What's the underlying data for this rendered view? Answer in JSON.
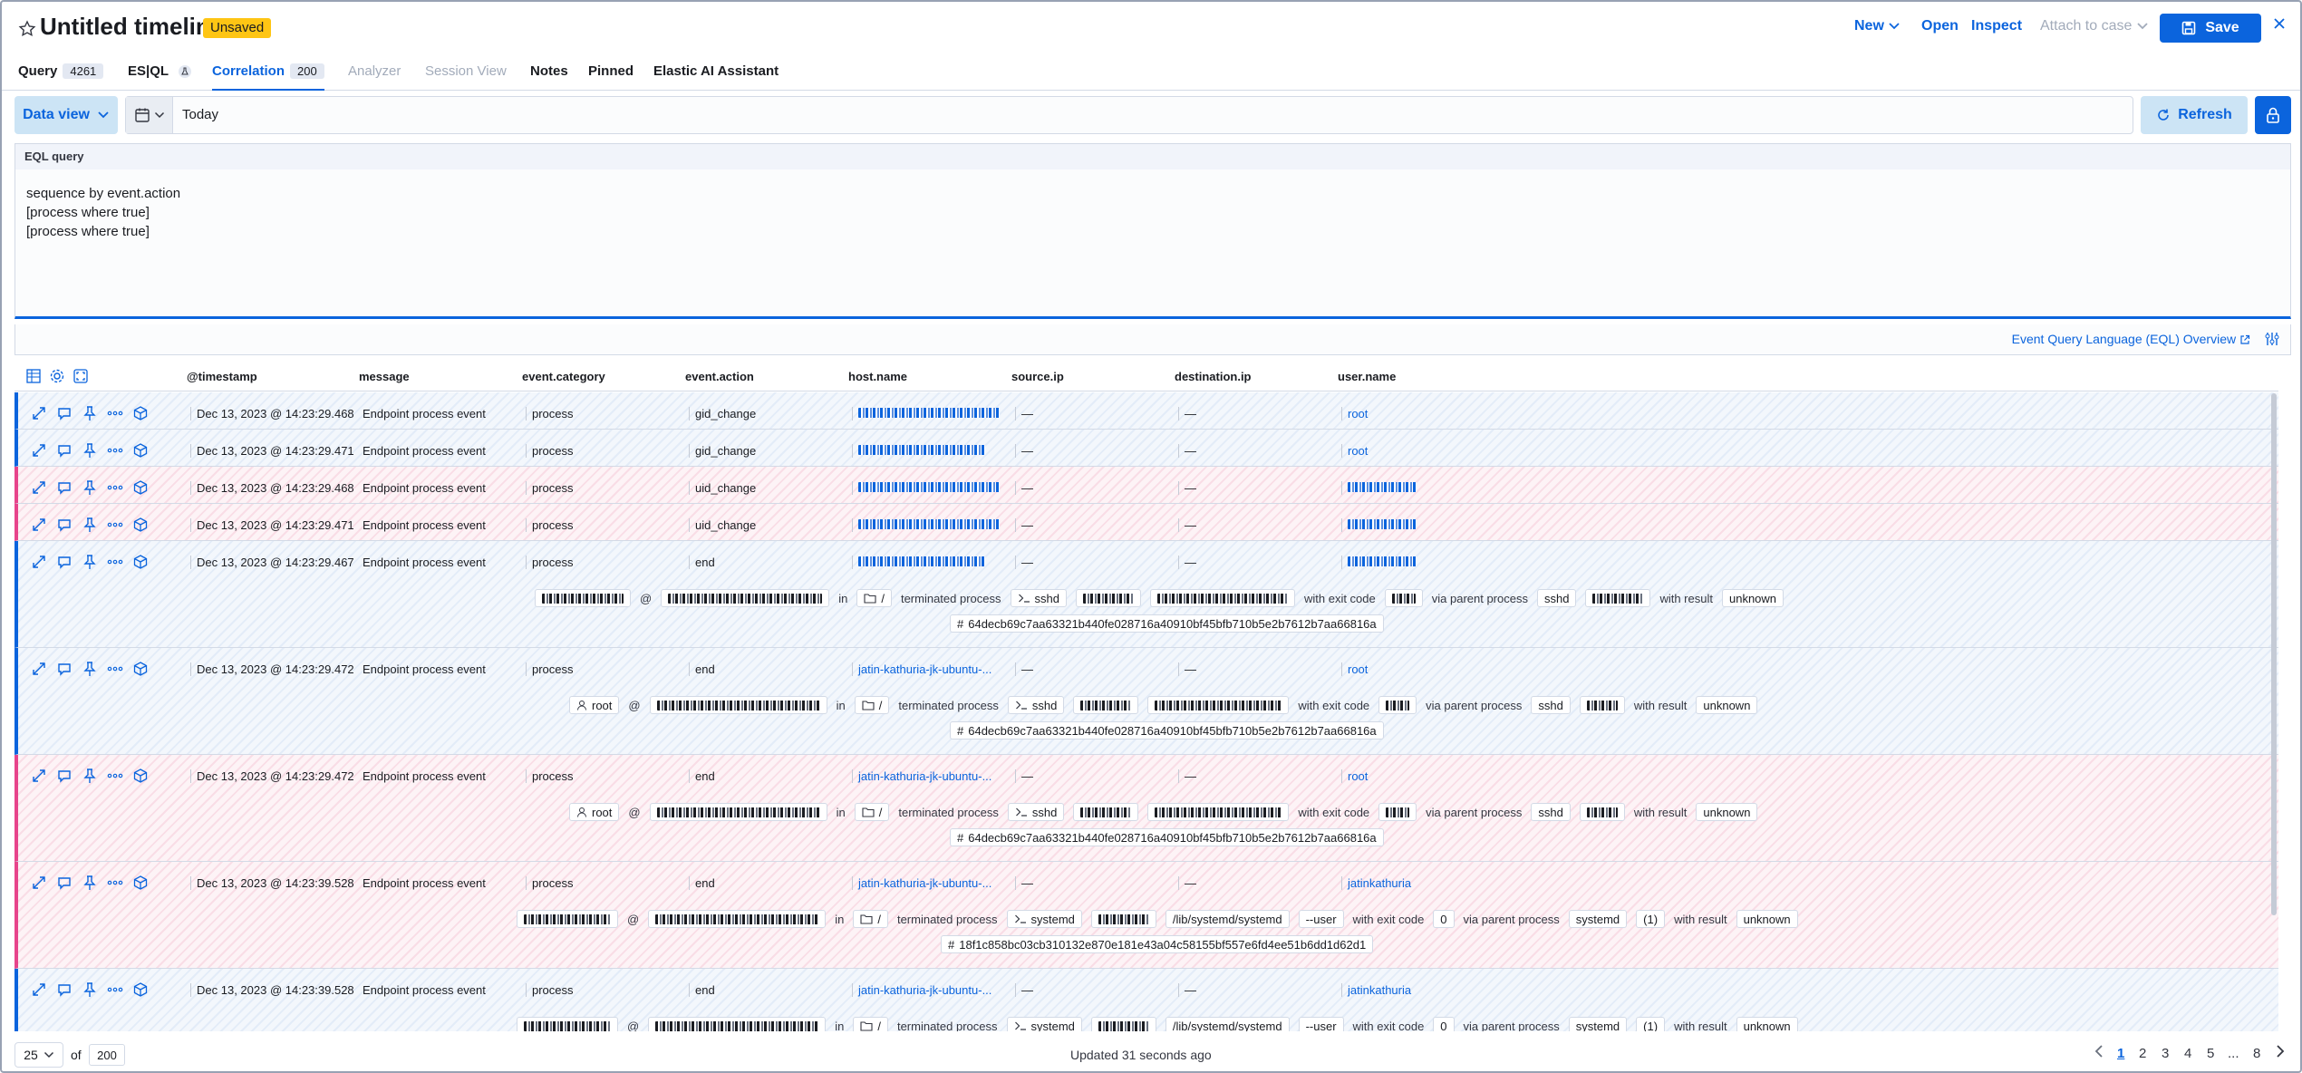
{
  "header": {
    "title": "Untitled timeline",
    "badge": "Unsaved",
    "actions": {
      "new": "New",
      "open": "Open",
      "inspect": "Inspect",
      "attach": "Attach to case",
      "save": "Save"
    }
  },
  "tabs": [
    {
      "label": "Query",
      "count": "4261"
    },
    {
      "label": "ES|QL"
    },
    {
      "label": "Correlation",
      "count": "200"
    },
    {
      "label": "Analyzer"
    },
    {
      "label": "Session View"
    },
    {
      "label": "Notes"
    },
    {
      "label": "Pinned"
    },
    {
      "label": "Elastic AI Assistant"
    }
  ],
  "querybar": {
    "data_view": "Data view",
    "date": "Today",
    "refresh": "Refresh"
  },
  "eql": {
    "label": "EQL query",
    "text": "sequence by event.action\n[process where true]\n[process where true]",
    "overview_link": "Event Query Language (EQL) Overview"
  },
  "columns": [
    "@timestamp",
    "message",
    "event.category",
    "event.action",
    "host.name",
    "source.ip",
    "destination.ip",
    "user.name"
  ],
  "rows": [
    {
      "ts": "Dec 13, 2023 @ 14:23:29.468",
      "msg": "Endpoint process event",
      "cat": "process",
      "act": "gid_change",
      "src": "—",
      "dst": "—",
      "user": "root"
    },
    {
      "ts": "Dec 13, 2023 @ 14:23:29.471",
      "msg": "Endpoint process event",
      "cat": "process",
      "act": "gid_change",
      "src": "—",
      "dst": "—",
      "user": "root"
    },
    {
      "ts": "Dec 13, 2023 @ 14:23:29.468",
      "msg": "Endpoint process event",
      "cat": "process",
      "act": "uid_change",
      "src": "—",
      "dst": "—"
    },
    {
      "ts": "Dec 13, 2023 @ 14:23:29.471",
      "msg": "Endpoint process event",
      "cat": "process",
      "act": "uid_change",
      "src": "—",
      "dst": "—"
    },
    {
      "ts": "Dec 13, 2023 @ 14:23:29.467",
      "msg": "Endpoint process event",
      "cat": "process",
      "act": "end",
      "src": "—",
      "dst": "—"
    },
    {
      "ts": "Dec 13, 2023 @ 14:23:29.472",
      "msg": "Endpoint process event",
      "cat": "process",
      "act": "end",
      "host": "jatin-kathuria-jk-ubuntu-...",
      "src": "—",
      "dst": "—",
      "user": "root"
    },
    {
      "ts": "Dec 13, 2023 @ 14:23:29.472",
      "msg": "Endpoint process event",
      "cat": "process",
      "act": "end",
      "host": "jatin-kathuria-jk-ubuntu-...",
      "src": "—",
      "dst": "—",
      "user": "root"
    },
    {
      "ts": "Dec 13, 2023 @ 14:23:39.528",
      "msg": "Endpoint process event",
      "cat": "process",
      "act": "end",
      "host": "jatin-kathuria-jk-ubuntu-...",
      "src": "—",
      "dst": "—",
      "user": "jatinkathuria"
    },
    {
      "ts": "Dec 13, 2023 @ 14:23:39.528",
      "msg": "Endpoint process event",
      "cat": "process",
      "act": "end",
      "host": "jatin-kathuria-jk-ubuntu-...",
      "src": "—",
      "dst": "—",
      "user": "jatinkathuria"
    }
  ],
  "summary": {
    "at": "@",
    "in": "in",
    "dir": "/",
    "terminated": "terminated process",
    "exit": "with exit code",
    "via": "via parent process",
    "result": "with result",
    "unknown": "unknown",
    "sshd": "sshd",
    "root": "root",
    "systemd": "systemd",
    "systemd_path": "/lib/systemd/systemd",
    "user_flag": "--user",
    "zero": "0",
    "paren1": "(1)",
    "hash1": "64decb69c7aa63321b440fe028716a40910bf45bfb710b5e2b7612b7aa66816a",
    "hash2": "18f1c858bc03cb310132e870e181e43a04c58155bf557e6fd4ee51b6dd1d62d1"
  },
  "footer": {
    "per_page": "25",
    "of": "of",
    "total": "200",
    "updated": "Updated 31 seconds ago",
    "pages": [
      "1",
      "2",
      "3",
      "4",
      "5",
      "...",
      "8"
    ]
  },
  "colors": {
    "accent": "#0b64dd",
    "badge": "#fec514",
    "row_blue": "#e3ecf8",
    "row_pink": "#f9dde6"
  }
}
